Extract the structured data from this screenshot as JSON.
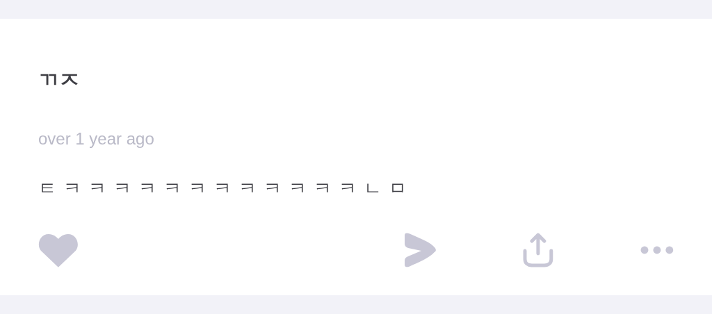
{
  "post": {
    "title": "ㄲㅈ",
    "time": "over 1 year ago",
    "body": "ㅌㅋㅋㅋㅋㅋㅋㅋㅋㅋㅋㅋㅋㄴㅁ",
    "liked": false
  }
}
